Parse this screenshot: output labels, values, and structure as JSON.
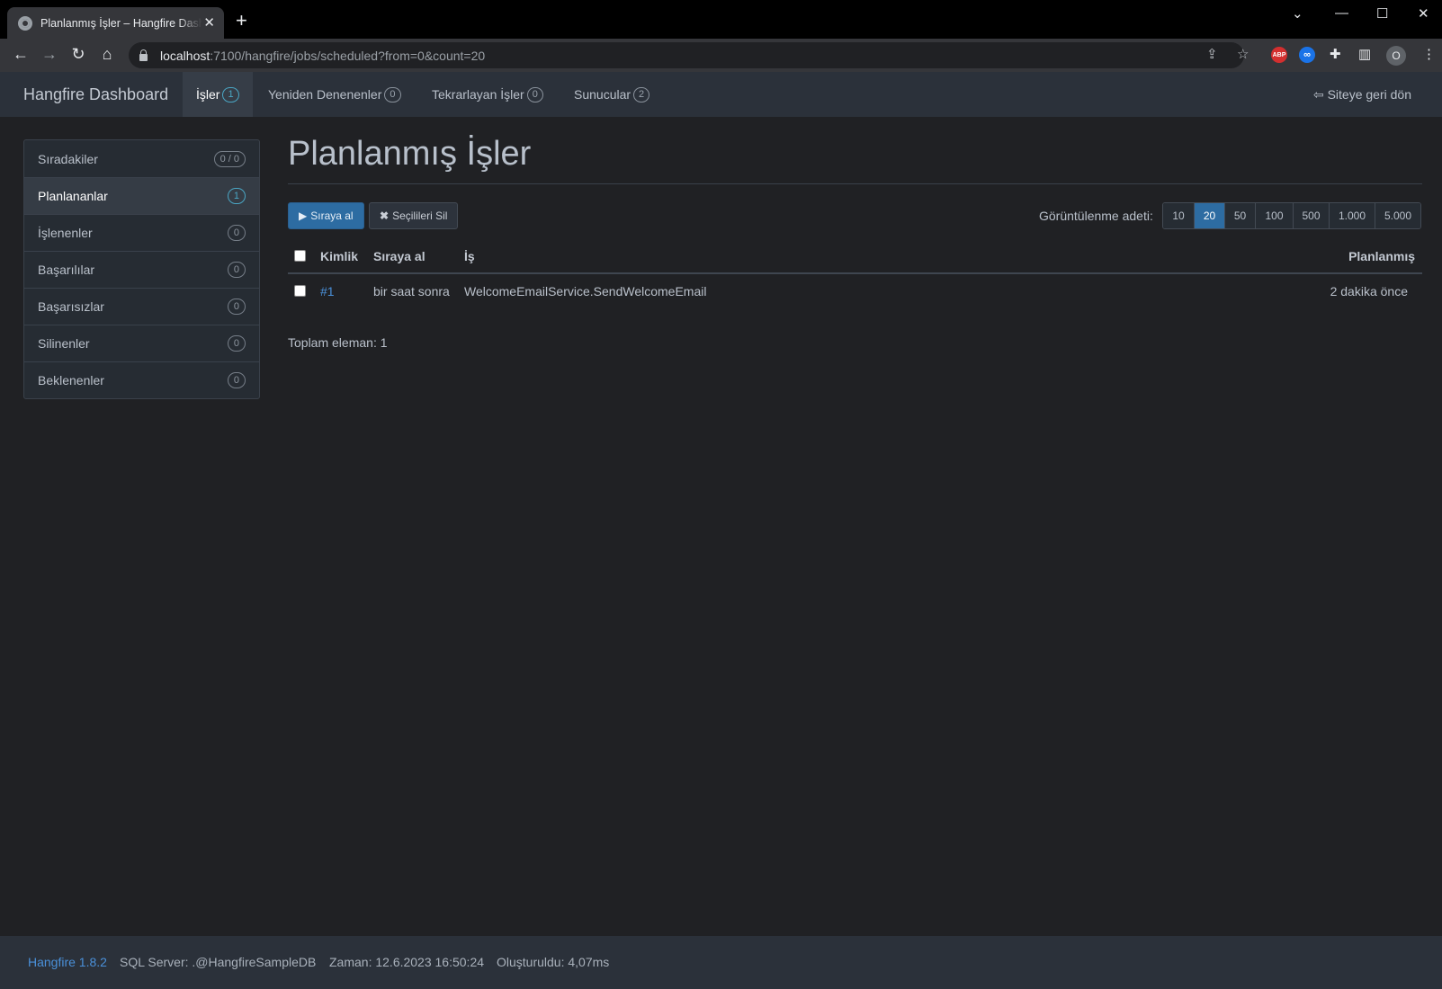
{
  "browser": {
    "tab_title": "Planlanmış İşler – Hangfire Dashboard",
    "close_glyph": "✕",
    "newtab_glyph": "+",
    "url_host": "localhost",
    "url_path": ":7100/hangfire/jobs/scheduled?from=0&count=20",
    "profile_initial": "O",
    "adblock_label": "ABP",
    "ext_label": "∞"
  },
  "navbar": {
    "brand": "Hangfire Dashboard",
    "items": [
      {
        "label": "İşler",
        "count": "1"
      },
      {
        "label": "Yeniden Denenenler",
        "count": "0"
      },
      {
        "label": "Tekrarlayan İşler",
        "count": "0"
      },
      {
        "label": "Sunucular",
        "count": "2"
      }
    ],
    "back_link": "Siteye geri dön"
  },
  "sidebar": {
    "items": [
      {
        "label": "Sıradakiler",
        "count": "0 / 0"
      },
      {
        "label": "Planlananlar",
        "count": "1"
      },
      {
        "label": "İşlenenler",
        "count": "0"
      },
      {
        "label": "Başarılılar",
        "count": "0"
      },
      {
        "label": "Başarısızlar",
        "count": "0"
      },
      {
        "label": "Silinenler",
        "count": "0"
      },
      {
        "label": "Beklenenler",
        "count": "0"
      }
    ]
  },
  "main": {
    "title": "Planlanmış İşler",
    "enqueue_button": "Sıraya al",
    "delete_button": "Seçilileri Sil",
    "per_page_label": "Görüntülenme adeti:",
    "per_page_options": [
      "10",
      "20",
      "50",
      "100",
      "500",
      "1.000",
      "5.000"
    ],
    "per_page_selected": "20",
    "table": {
      "headers": [
        "Kimlik",
        "Sıraya al",
        "İş",
        "Planlanmış"
      ],
      "rows": [
        {
          "id": "#1",
          "enqueue": "bir saat sonra",
          "job": "WelcomeEmailService.SendWelcomeEmail",
          "scheduled": "2 dakika önce"
        }
      ]
    },
    "total": "Toplam eleman: 1"
  },
  "footer": {
    "version": "Hangfire 1.8.2",
    "storage": "SQL Server: .@HangfireSampleDB",
    "time": "Zaman: 12.6.2023 16:50:24",
    "generated": "Oluşturuldu: 4,07ms"
  },
  "colors": {
    "background": "#202124",
    "navbar": "#2b313a",
    "primary": "#2d6ca2",
    "link": "#4a90d9",
    "badge_active": "#4aa6c4"
  }
}
